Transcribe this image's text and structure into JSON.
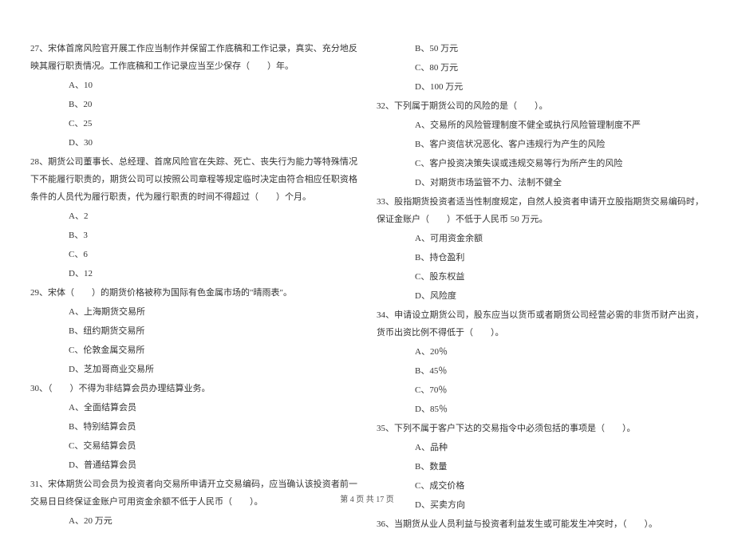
{
  "left_column": {
    "q27": {
      "text": "27、宋体首席风险官开展工作应当制作并保留工作底稿和工作记录，真实、充分地反映其履行职责情况。工作底稿和工作记录应当至少保存（　　）年。",
      "options": [
        "A、10",
        "B、20",
        "C、25",
        "D、30"
      ]
    },
    "q28": {
      "text": "28、期货公司董事长、总经理、首席风险官在失踪、死亡、丧失行为能力等特殊情况下不能履行职责的，期货公司可以按照公司章程等规定临时决定由符合相应任职资格条件的人员代为履行职责，代为履行职责的时间不得超过（　　）个月。",
      "options": [
        "A、2",
        "B、3",
        "C、6",
        "D、12"
      ]
    },
    "q29": {
      "text": "29、宋体（　　）的期货价格被称为国际有色金属市场的\"晴雨表\"。",
      "options": [
        "A、上海期货交易所",
        "B、纽约期货交易所",
        "C、伦敦金属交易所",
        "D、芝加哥商业交易所"
      ]
    },
    "q30": {
      "text": "30、（　　）不得为非结算会员办理结算业务。",
      "options": [
        "A、全面结算会员",
        "B、特别结算会员",
        "C、交易结算会员",
        "D、普通结算会员"
      ]
    },
    "q31": {
      "text": "31、宋体期货公司会员为投资者向交易所申请开立交易编码，应当确认该投资者前一交易日日终保证金账户可用资金余额不低于人民币（　　）。",
      "options": [
        "A、20 万元"
      ]
    }
  },
  "right_column": {
    "q31_cont": {
      "options": [
        "B、50 万元",
        "C、80 万元",
        "D、100 万元"
      ]
    },
    "q32": {
      "text": "32、下列属于期货公司的风险的是（　　）。",
      "options": [
        "A、交易所的风险管理制度不健全或执行风险管理制度不严",
        "B、客户资信状况恶化、客户违规行为产生的风险",
        "C、客户投资决策失误或违规交易等行为所产生的风险",
        "D、对期货市场监管不力、法制不健全"
      ]
    },
    "q33": {
      "text": "33、股指期货投资者适当性制度规定，自然人投资者申请开立股指期货交易编码时，保证金账户（　　）不低于人民币 50 万元。",
      "options": [
        "A、可用资金余额",
        "B、持仓盈利",
        "C、股东权益",
        "D、风险度"
      ]
    },
    "q34": {
      "text": "34、申请设立期货公司，股东应当以货币或者期货公司经营必需的非货币财产出资，货币出资比例不得低于（　　）。",
      "options": [
        "A、20％",
        "B、45％",
        "C、70％",
        "D、85％"
      ]
    },
    "q35": {
      "text": "35、下列不属于客户下达的交易指令中必须包括的事项是（　　）。",
      "options": [
        "A、品种",
        "B、数量",
        "C、成交价格",
        "D、买卖方向"
      ]
    },
    "q36": {
      "text": "36、当期货从业人员利益与投资者利益发生或可能发生冲突时，（　　）。"
    }
  },
  "footer": "第 4 页 共 17 页"
}
